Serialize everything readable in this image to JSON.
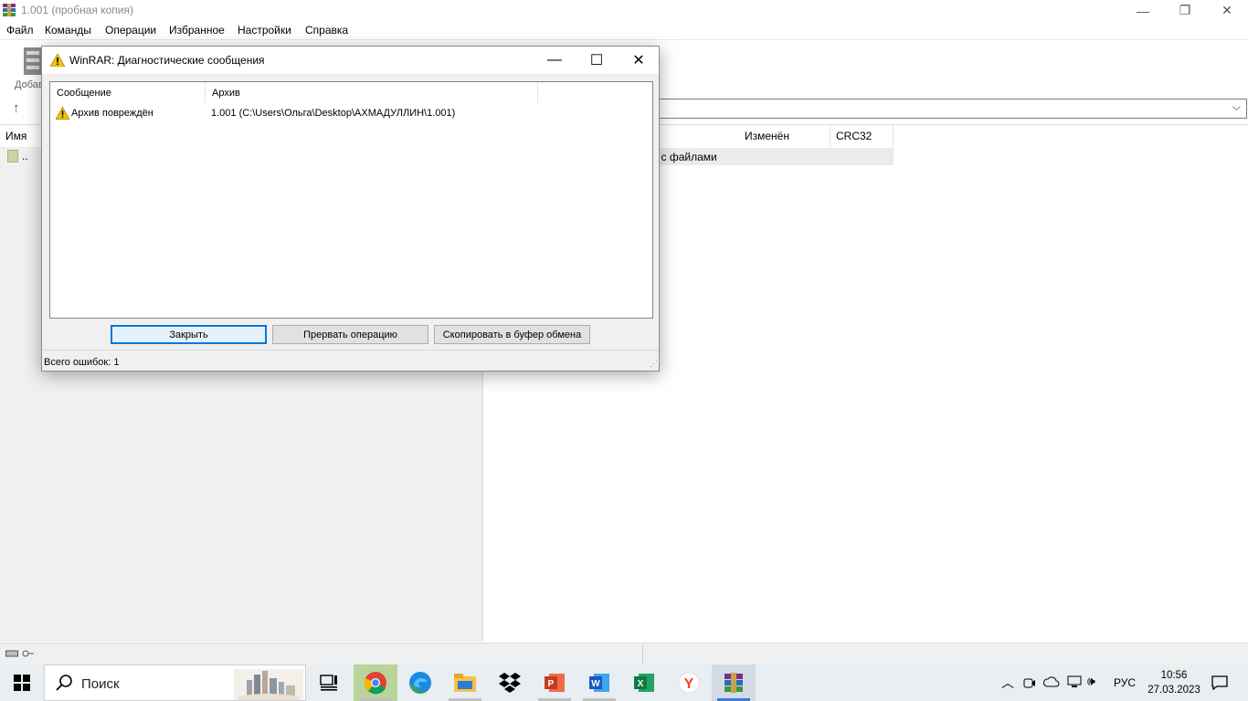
{
  "main_window": {
    "title": "1.001 (пробная копия)",
    "controls": {
      "minimize": "—",
      "restore": "❐",
      "close": "✕"
    }
  },
  "menubar": {
    "items": [
      "Файл",
      "Команды",
      "Операции",
      "Избранное",
      "Настройки",
      "Справка"
    ]
  },
  "toolbar": {
    "partial_label": "Добав"
  },
  "file_list": {
    "columns": [
      "Имя",
      "Изменён",
      "CRC32"
    ],
    "rows": [
      {
        "name": "..",
        "type_partial": "ка с файлами"
      }
    ]
  },
  "dialog": {
    "title": "WinRAR: Диагностические сообщения",
    "columns": {
      "message": "Сообщение",
      "archive": "Архив"
    },
    "messages": [
      {
        "message": "Архив повреждён",
        "archive": "1.001 (C:\\Users\\Ольга\\Desktop\\АХМАДУЛЛИН\\1.001)"
      }
    ],
    "buttons": {
      "close": "Закрыть",
      "abort": "Прервать операцию",
      "copy": "Скопировать в буфер обмена"
    },
    "status": "Всего ошибок: 1"
  },
  "taskbar": {
    "search_placeholder": "Поиск",
    "apps": [
      "task-view",
      "chrome",
      "edge",
      "file-explorer",
      "dropbox",
      "powerpoint",
      "word",
      "excel",
      "yandex-browser",
      "winrar"
    ],
    "language": "РУС",
    "time": "10:56",
    "date": "27.03.2023"
  },
  "colors": {
    "accent": "#0078d7",
    "warning": "#f5c400",
    "taskbar": "#e8eef1"
  }
}
